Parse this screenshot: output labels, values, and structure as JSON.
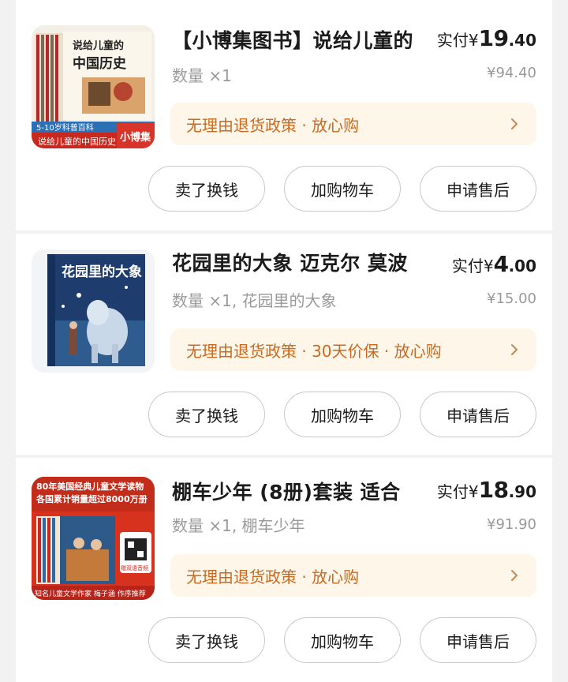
{
  "orders": [
    {
      "title": "【小博集图书】说给儿童的",
      "price_prefix": "实付",
      "price_currency": "¥",
      "price_int": "19",
      "price_dec": ".40",
      "quantity": "数量 ×1",
      "original_price": "¥94.40",
      "policy": "无理由退货政策 · 放心购",
      "cover": {
        "badge_text": "说给儿童的中国历史",
        "top_text": "说给儿童的",
        "big_text": "中国历史",
        "age_text": "5-10岁科普百科",
        "brand_text": "小博集",
        "accent": "#c8281e"
      },
      "buttons": [
        "卖了换钱",
        "加购物车",
        "申请售后"
      ]
    },
    {
      "title": "花园里的大象 迈克尔 莫波",
      "price_prefix": "实付",
      "price_currency": "¥",
      "price_int": "4",
      "price_dec": ".00",
      "quantity": "数量 ×1, 花园里的大象",
      "original_price": "¥15.00",
      "policy": "无理由退货政策 · 30天价保 · 放心购",
      "cover": {
        "title_text": "花园里的大象",
        "accent": "#1e3c6e"
      },
      "buttons": [
        "卖了换钱",
        "加购物车",
        "申请售后"
      ]
    },
    {
      "title": "棚车少年 (8册)套装 适合",
      "price_prefix": "实付",
      "price_currency": "¥",
      "price_int": "18",
      "price_dec": ".90",
      "quantity": "数量 ×1, 棚车少年",
      "original_price": "¥91.90",
      "policy": "无理由退货政策 · 放心购",
      "cover": {
        "line1": "80年美国经典儿童文学读物",
        "line2": "各国累计销量超过8000万册",
        "bottom_text": "知名儿童文学作家 梅子涵 作序推荐",
        "audio_text": "赠双语音频",
        "accent": "#d6321e"
      },
      "buttons": [
        "卖了换钱",
        "加购物车",
        "申请售后"
      ]
    }
  ],
  "colors": {
    "policy_bg": "#fff6ea",
    "policy_text": "#c96a1f",
    "muted_text": "#9a9a9a",
    "page_bg": "#f2f2f2"
  },
  "icons": {
    "policy_arrow": "chevron-right-icon"
  }
}
